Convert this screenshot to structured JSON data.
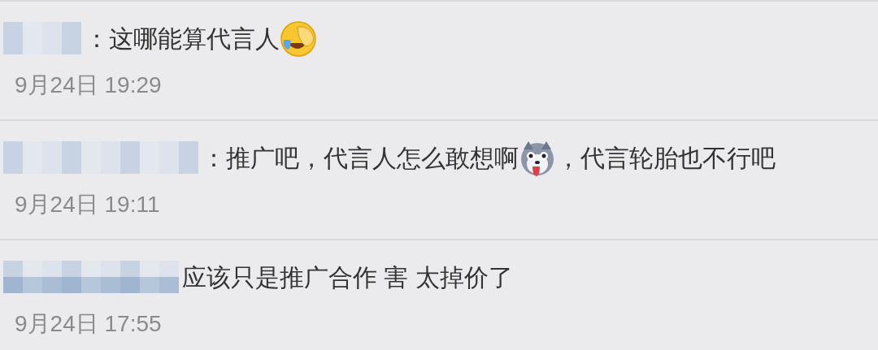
{
  "comments": [
    {
      "author": {
        "redacted": true
      },
      "parts": [
        {
          "kind": "text",
          "text": "：这哪能算代言人"
        },
        {
          "kind": "emoji-face"
        }
      ],
      "time": "9月24日 19:29"
    },
    {
      "author": {
        "redacted": true
      },
      "parts": [
        {
          "kind": "text",
          "text": "：推广吧，代言人怎么敢想啊"
        },
        {
          "kind": "emoji-dog"
        },
        {
          "kind": "text",
          "text": "，代言轮胎也不行吧"
        }
      ],
      "time": "9月24日 19:11"
    },
    {
      "author": {
        "redacted": true
      },
      "parts": [
        {
          "kind": "text",
          "text": "应该只是推广合作 害 太掉价了"
        }
      ],
      "time": "9月24日 17:55"
    }
  ]
}
